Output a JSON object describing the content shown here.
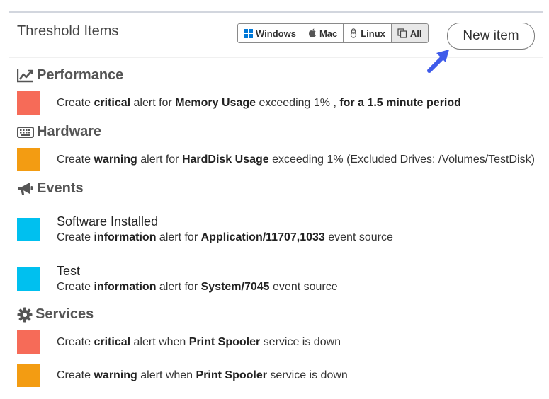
{
  "header": {
    "title": "Threshold Items",
    "os_filter": [
      {
        "label": "Windows",
        "icon": "windows-icon"
      },
      {
        "label": "Mac",
        "icon": "apple-icon"
      },
      {
        "label": "Linux",
        "icon": "linux-icon"
      },
      {
        "label": "All",
        "icon": "copy-icon",
        "active": true
      }
    ],
    "new_item_label": "New item"
  },
  "colors": {
    "critical": "#f66b58",
    "warning": "#f39c12",
    "information": "#00c0ef"
  },
  "sections": {
    "performance": {
      "title": "Performance",
      "icon": "line-chart-icon",
      "items": [
        {
          "severity": "critical",
          "t1": "Create ",
          "b1": "critical",
          "t2": " alert for ",
          "b2": "Memory Usage",
          "t3": " exceeding 1% , ",
          "b3": "for a 1.5 minute period"
        }
      ]
    },
    "hardware": {
      "title": "Hardware",
      "icon": "keyboard-icon",
      "items": [
        {
          "severity": "warning",
          "t1": "Create ",
          "b1": "warning",
          "t2": " alert for ",
          "b2": "HardDisk Usage",
          "t3": " exceeding 1% (Excluded Drives: /Volumes/TestDisk)"
        }
      ]
    },
    "events": {
      "title": "Events",
      "icon": "bullhorn-icon",
      "items": [
        {
          "name": "Software Installed",
          "severity": "information",
          "t1": "Create ",
          "b1": "information",
          "t2": " alert for ",
          "b2": "Application/11707,1033",
          "t3": " event source"
        },
        {
          "name": "Test",
          "severity": "information",
          "t1": "Create ",
          "b1": "information",
          "t2": " alert for ",
          "b2": "System/7045",
          "t3": " event source"
        }
      ]
    },
    "services": {
      "title": "Services",
      "icon": "gear-icon",
      "items": [
        {
          "severity": "critical",
          "t1": "Create ",
          "b1": "critical",
          "t2": " alert when ",
          "b2": "Print Spooler",
          "t3": " service is down"
        },
        {
          "severity": "warning",
          "t1": "Create ",
          "b1": "warning",
          "t2": " alert when ",
          "b2": "Print Spooler",
          "t3": " service is down"
        }
      ]
    }
  }
}
